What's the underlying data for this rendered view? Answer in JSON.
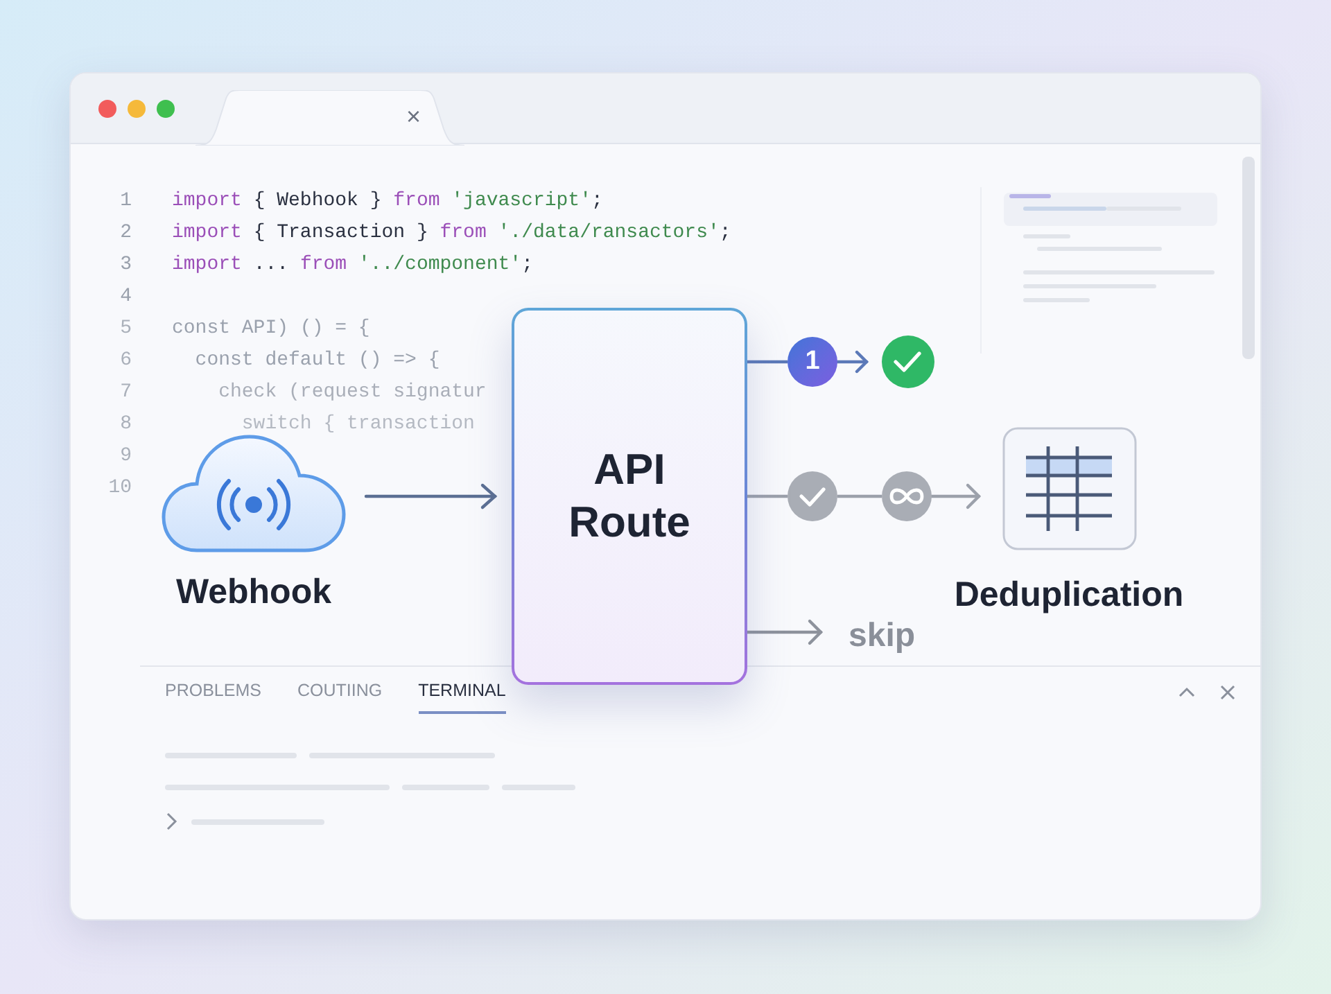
{
  "window": {
    "tab": {
      "close": "×"
    }
  },
  "code_lines": [
    {
      "number": "1",
      "tokens": [
        {
          "text": "import",
          "kind": "keyword"
        },
        {
          "text": " { Webhook } ",
          "kind": "ident"
        },
        {
          "text": "from",
          "kind": "keyword"
        },
        {
          "text": " 'javascript'",
          "kind": "string"
        },
        {
          "text": ";",
          "kind": "ident"
        }
      ]
    },
    {
      "number": "2",
      "tokens": [
        {
          "text": "import",
          "kind": "keyword"
        },
        {
          "text": " { Transaction } ",
          "kind": "ident"
        },
        {
          "text": "from",
          "kind": "keyword"
        },
        {
          "text": " './data/ransactors'",
          "kind": "string"
        },
        {
          "text": ";",
          "kind": "ident"
        }
      ]
    },
    {
      "number": "3",
      "tokens": [
        {
          "text": "import",
          "kind": "keyword"
        },
        {
          "text": " ... ",
          "kind": "ident"
        },
        {
          "text": "from",
          "kind": "keyword"
        },
        {
          "text": " '../component'",
          "kind": "string"
        },
        {
          "text": ";",
          "kind": "ident"
        }
      ]
    },
    {
      "number": "4"
    },
    {
      "number": "5",
      "tokens": [
        {
          "text": "const API) () = {",
          "kind": "faded"
        }
      ]
    },
    {
      "number": "6",
      "tokens": [
        {
          "text": "  const default () => {",
          "kind": "faded"
        }
      ]
    },
    {
      "number": "7",
      "tokens": [
        {
          "text": "    check (request signatur",
          "kind": "faint"
        }
      ]
    },
    {
      "number": "8",
      "tokens": [
        {
          "text": "      switch { transaction",
          "kind": "ghost"
        }
      ]
    },
    {
      "number": "9"
    },
    {
      "number": "10"
    }
  ],
  "diagram": {
    "source": {
      "label": "Webhook"
    },
    "router": {
      "label": "API Route"
    },
    "step_badge": "1",
    "target": {
      "label": "Deduplication"
    },
    "skip_label": "skip"
  },
  "panel": {
    "tabs": [
      {
        "label": "PROBLEMS",
        "selected": false
      },
      {
        "label": "COUTIING",
        "selected": false
      },
      {
        "label": "TERMINAL",
        "selected": true
      }
    ]
  }
}
